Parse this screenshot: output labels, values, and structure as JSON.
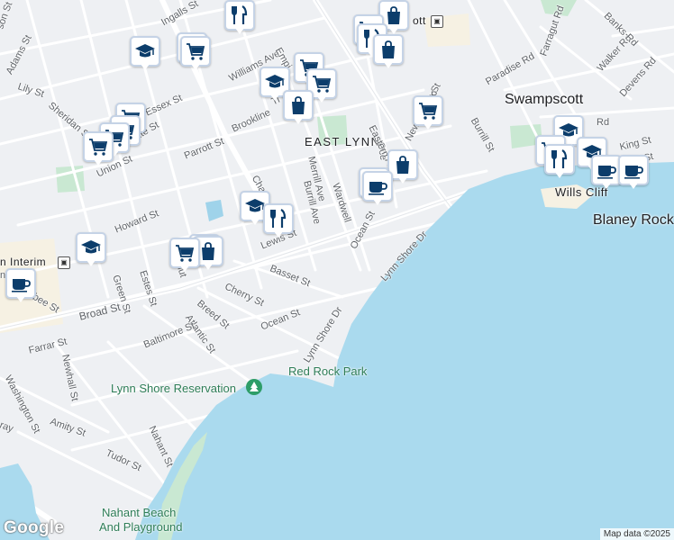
{
  "map": {
    "neighborhoods": {
      "swampscott": "Swampscott",
      "east_lynn": "EAST LYNN"
    },
    "places": {
      "blaney_rock": "Blaney Rock",
      "wills_cliff": "Wills Cliff",
      "red_rock_park": "Red Rock Park",
      "lynn_shore_reservation": "Lynn Shore Reservation",
      "nahant_beach_1": "Nahant Beach",
      "nahant_beach_2": "And Playground",
      "station_partial": "ott",
      "lynn_interim": "n Interim"
    },
    "streets": {
      "ingalls": "Ingalls St",
      "adams": "Adams St",
      "lily": "Lily St",
      "sheridan": "Sheridan St",
      "essex": "Essex St",
      "williams": "Williams Ave",
      "empire": "Empi",
      "brookline": "Brookline",
      "ti": "Ti",
      "parrott": "Parrott St",
      "union": "Union St",
      "fayette": "ette St",
      "chase": "Cha",
      "howard": "Howard St",
      "green": "Green St",
      "estes": "Estes St",
      "chestnut": "Chestnut",
      "lewis": "Lewis St",
      "basset": "Basset St",
      "cherry": "Cherry St",
      "breed": "Breed St",
      "atlantic": "Atlantic St",
      "baltimore": "Baltimore St",
      "ocean1": "Ocean St",
      "ocean2": "Ocean St",
      "ocean3": "Oce",
      "broad": "Broad St",
      "farrar": "Farrar St",
      "newhall": "Newhall St",
      "washington": "Washington St",
      "amity": "Amity St",
      "nahant": "Nahant St",
      "tudor": "Tudor St",
      "lynn_shore_1": "Lynn Shore Dr",
      "lynn_shore_2": "Lynn Shore Dr",
      "merrill": "Merrill Ave",
      "burrill_ave": "Burrill Ave",
      "wardwell": "Wardwell",
      "eastern": "Eastern Ave",
      "new_ocean": "New Ocean St",
      "burrill_st": "Burrill St",
      "paradise": "Paradise Rd",
      "farragut": "Farragut Rd",
      "walker": "Walker Rd",
      "devens": "Devens Rd",
      "banks": "Banks Rd",
      "king": "King St",
      "rd1": "Rd",
      "nd": "nd St",
      "nut": "nut St",
      "son": "son St",
      "lisbee": "lisbee St",
      "ray": "ray",
      "p": "P"
    }
  },
  "pins": [
    {
      "type": "dining",
      "icon": "fork-knife-icon"
    },
    {
      "type": "shopping",
      "icon": "shopping-bag-icon"
    },
    {
      "type": "education",
      "icon": "graduation-cap-icon"
    },
    {
      "type": "grocery",
      "icon": "shopping-cart-icon"
    },
    {
      "type": "cafe",
      "icon": "coffee-cup-icon"
    }
  ],
  "footer": {
    "logo": "Google",
    "attribution": "Map data ©2025"
  },
  "colors": {
    "water": "#aadaee",
    "land": "#eef0f3",
    "road": "#ffffff",
    "park": "#c9e8d2",
    "pin_icon": "#0c3d6b",
    "pin_border": "#c5d3e6"
  }
}
